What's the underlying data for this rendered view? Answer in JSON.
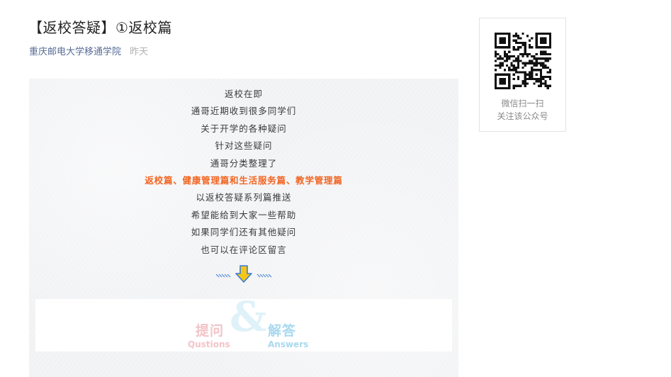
{
  "article": {
    "title": "【返校答疑】①返校篇",
    "account_name": "重庆邮电大学移通学院",
    "publish_time": "昨天"
  },
  "intro_lines": [
    "返校在即",
    "通哥近期收到很多同学们",
    "关于开学的各种疑问",
    "针对这些疑问",
    "通哥分类整理了",
    "返校篇、健康管理篇和生活服务篇、教学管理篇",
    "以返校答疑系列篇推送",
    "希望能给到大家一些帮助",
    "如果同学们还有其他疑问",
    "也可以在评论区留言"
  ],
  "banner": {
    "ask_cn": "提问",
    "ask_en": "Qustions",
    "amp": "&",
    "answer_cn": "解答",
    "answer_en": "Answers"
  },
  "qr": {
    "caption_line1": "微信扫一扫",
    "caption_line2": "关注该公众号"
  },
  "colors": {
    "highlight": "#f26522",
    "account_link": "#576b95",
    "arrow": "#f5c518",
    "arrow_stripes": "#3a7bd5"
  },
  "icons": {
    "down_arrow": "down-arrow-icon",
    "qr_code": "qr-code-icon"
  }
}
